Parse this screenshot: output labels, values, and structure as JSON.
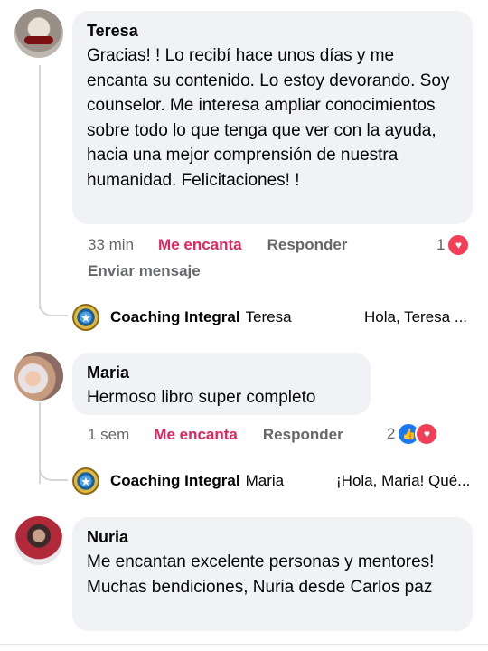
{
  "comments": [
    {
      "author": "Teresa",
      "text": "Gracias! ! Lo recibí hace unos días y me encanta su contenido. Lo estoy devorando. Soy counselor. Me interesa ampliar conocimientos sobre todo lo que tenga que ver con la ayuda, hacia una mejor comprensión de nuestra humanidad. Felicitaciones! !",
      "time": "33 min",
      "love_label": "Me encanta",
      "reply_label": "Responder",
      "send_message_label": "Enviar mensaje",
      "reaction_count": "1",
      "reply_preview": {
        "author": "Coaching Integral",
        "to": "Teresa",
        "snippet": "Hola, Teresa ..."
      }
    },
    {
      "author": "Maria",
      "text": "Hermoso libro super completo",
      "time": "1 sem",
      "love_label": "Me encanta",
      "reply_label": "Responder",
      "reaction_count": "2",
      "reply_preview": {
        "author": "Coaching Integral",
        "to": "Maria",
        "snippet": "¡Hola, Maria! Qué..."
      }
    },
    {
      "author": "Nuria",
      "text": "Me encantan excelente personas y mentores! Muchas bendiciones, Nuria desde Carlos paz"
    }
  ],
  "colors": {
    "bubble": "#f0f2f5",
    "love": "#e0245e",
    "meta": "#65676b",
    "heart": "#f33e58",
    "like": "#1877f2"
  },
  "icons": {
    "heart": "heart-reaction-icon",
    "like": "like-reaction-icon"
  }
}
